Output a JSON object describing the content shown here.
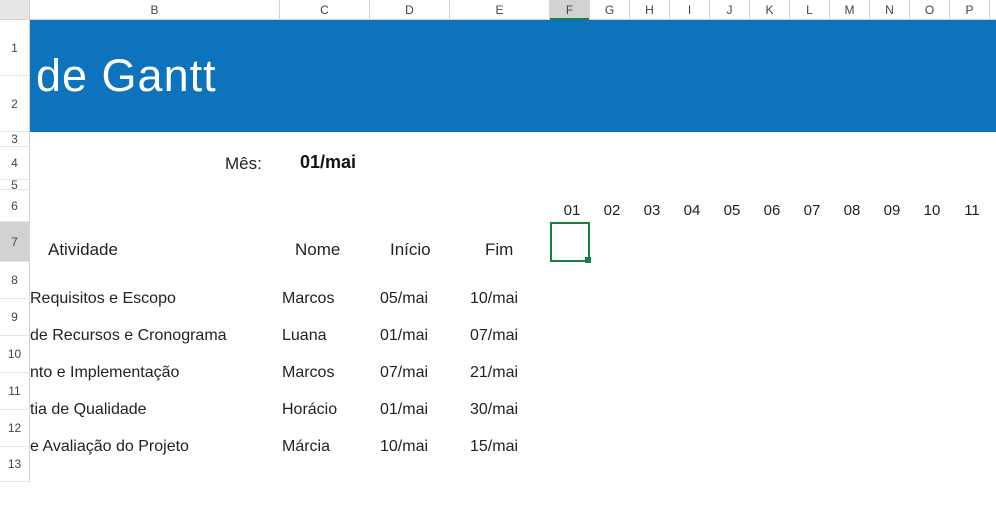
{
  "columns": [
    {
      "label": "B",
      "cls": "cB"
    },
    {
      "label": "C",
      "cls": "cC"
    },
    {
      "label": "D",
      "cls": "cD"
    },
    {
      "label": "E",
      "cls": "cE"
    },
    {
      "label": "F",
      "cls": "cNarrow",
      "selected": true
    },
    {
      "label": "G",
      "cls": "cNarrow"
    },
    {
      "label": "H",
      "cls": "cNarrow"
    },
    {
      "label": "I",
      "cls": "cNarrow"
    },
    {
      "label": "J",
      "cls": "cNarrow"
    },
    {
      "label": "K",
      "cls": "cNarrow"
    },
    {
      "label": "L",
      "cls": "cNarrow"
    },
    {
      "label": "M",
      "cls": "cNarrow"
    },
    {
      "label": "N",
      "cls": "cNarrow"
    },
    {
      "label": "O",
      "cls": "cNarrow"
    },
    {
      "label": "P",
      "cls": "cNarrow"
    }
  ],
  "rows": [
    {
      "label": "1",
      "cls": "r1"
    },
    {
      "label": "2",
      "cls": "r2"
    },
    {
      "label": "3",
      "cls": "r3"
    },
    {
      "label": "4",
      "cls": "r4"
    },
    {
      "label": "5",
      "cls": "r5"
    },
    {
      "label": "6",
      "cls": "r6"
    },
    {
      "label": "7",
      "cls": "r7",
      "selected": true
    },
    {
      "label": "8",
      "cls": "r8"
    },
    {
      "label": "9",
      "cls": "r9"
    },
    {
      "label": "10",
      "cls": "r10"
    },
    {
      "label": "11",
      "cls": "r11"
    },
    {
      "label": "12",
      "cls": "r12"
    },
    {
      "label": "13",
      "cls": "r13"
    }
  ],
  "title": "de Gantt",
  "month": {
    "label": "Mês:",
    "value": "01/mai"
  },
  "days": [
    "01",
    "02",
    "03",
    "04",
    "05",
    "06",
    "07",
    "08",
    "09",
    "10",
    "11"
  ],
  "headers": {
    "atividade": "Atividade",
    "nome": "Nome",
    "inicio": "Início",
    "fim": "Fim"
  },
  "activities": [
    {
      "atividade": "Requisitos e Escopo",
      "nome": "Marcos",
      "inicio": "05/mai",
      "fim": "10/mai"
    },
    {
      "atividade": " de Recursos e Cronograma",
      "nome": "Luana",
      "inicio": "01/mai",
      "fim": "07/mai"
    },
    {
      "atividade": "nto e Implementação",
      "nome": "Marcos",
      "inicio": "07/mai",
      "fim": "21/mai"
    },
    {
      "atividade": "tia de Qualidade",
      "nome": "Horácio",
      "inicio": "01/mai",
      "fim": "30/mai"
    },
    {
      "atividade": " e Avaliação do Projeto",
      "nome": "Márcia",
      "inicio": "10/mai",
      "fim": "15/mai"
    }
  ],
  "active_cell": "F7"
}
